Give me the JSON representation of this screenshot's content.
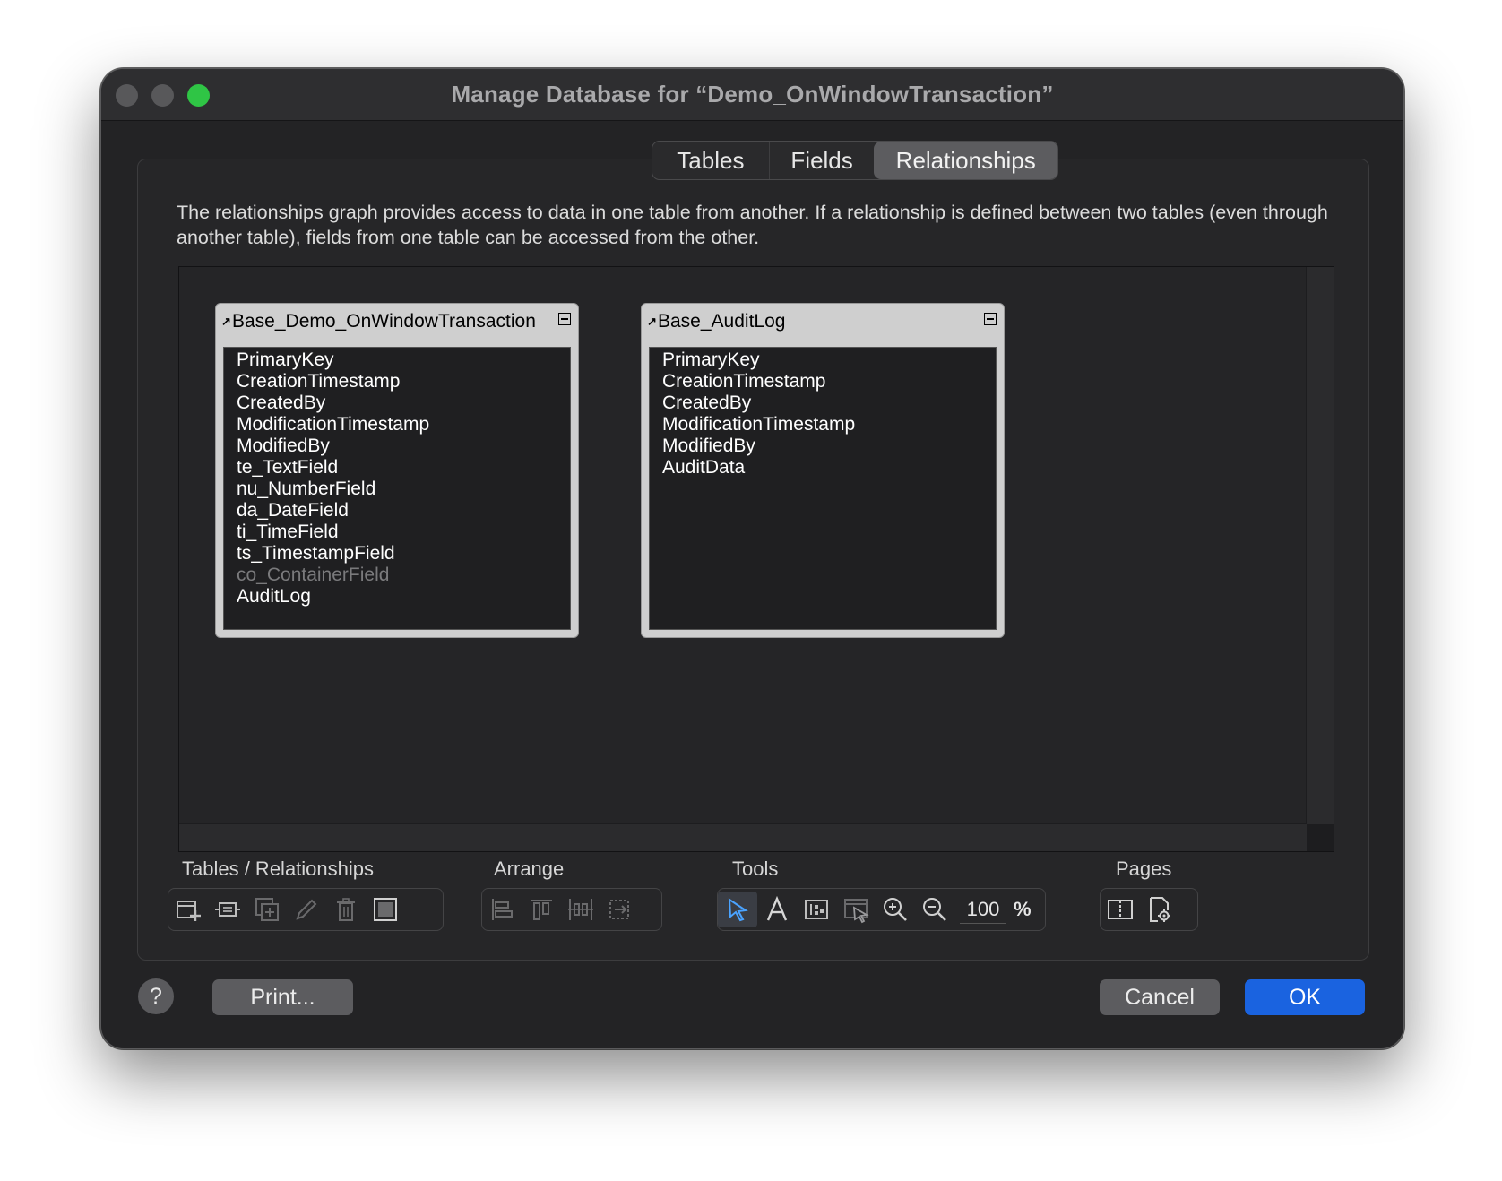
{
  "window": {
    "title": "Manage Database for “Demo_OnWindowTransaction”"
  },
  "tabs": [
    {
      "label": "Tables"
    },
    {
      "label": "Fields"
    },
    {
      "label": "Relationships",
      "selected": true
    }
  ],
  "description": "The relationships graph provides access to data in one table from another. If a relationship is defined between two tables (even through another table), fields from one table can be accessed from the other.",
  "graph": {
    "tables": [
      {
        "name": "Base_Demo_OnWindowTransaction",
        "fields": [
          "PrimaryKey",
          "CreationTimestamp",
          "CreatedBy",
          "ModificationTimestamp",
          "ModifiedBy",
          "te_TextField",
          "nu_NumberField",
          "da_DateField",
          "ti_TimeField",
          "ts_TimestampField",
          "co_ContainerField",
          "AuditLog"
        ]
      },
      {
        "name": "Base_AuditLog",
        "fields": [
          "PrimaryKey",
          "CreationTimestamp",
          "CreatedBy",
          "ModificationTimestamp",
          "ModifiedBy",
          "AuditData"
        ]
      }
    ]
  },
  "toolbar": {
    "tables_relationships": {
      "label": "Tables / Relationships"
    },
    "arrange": {
      "label": "Arrange"
    },
    "tools": {
      "label": "Tools",
      "zoom": "100",
      "zoom_unit": "%"
    },
    "pages": {
      "label": "Pages"
    }
  },
  "buttons": {
    "help": "?",
    "print": "Print...",
    "cancel": "Cancel",
    "ok": "OK"
  },
  "colors": {
    "accent": "#1a63e0",
    "window_bg": "#232325",
    "zoom_green": "#2fc545",
    "selected_tool": "#4aa3ff"
  }
}
